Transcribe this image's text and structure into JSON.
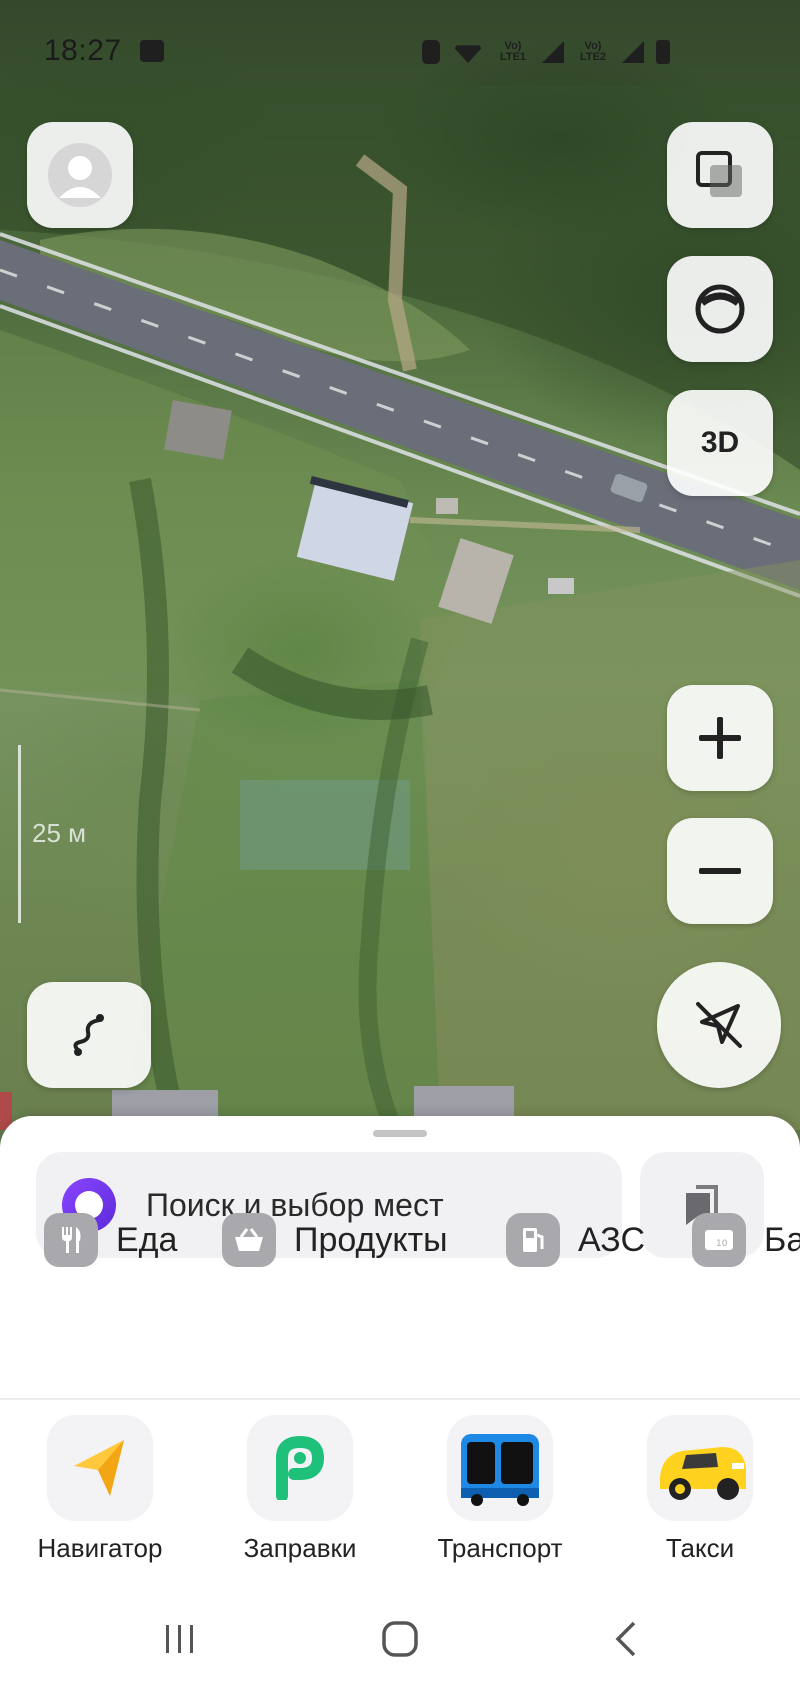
{
  "status_bar": {
    "time": "18:27",
    "lte1": "Vo) LTE1",
    "lte2": "Vo) LTE2",
    "icons": [
      "gallery-icon",
      "alarm-icon",
      "wifi-icon",
      "signal-icon",
      "signal-icon",
      "battery-icon"
    ]
  },
  "map": {
    "layers_icon": "layers-icon",
    "orientation_icon": "compass-icon",
    "btn_3d_label": "3D",
    "zoom_in_label": "+",
    "zoom_out_label": "−",
    "scale_label": "25 м",
    "route_icon": "route-icon",
    "location_icon": "location-off-icon"
  },
  "search": {
    "placeholder": "Поиск и выбор мест",
    "bookmarks_icon": "bookmarks-icon"
  },
  "categories": [
    {
      "label": "Еда",
      "icon": "fork-knife-icon"
    },
    {
      "label": "Продукты",
      "icon": "basket-icon"
    },
    {
      "label": "АЗС",
      "icon": "fuel-icon"
    },
    {
      "label": "Ба",
      "icon": "atm-icon"
    }
  ],
  "apps": [
    {
      "label": "Навигатор",
      "icon": "navigator-icon"
    },
    {
      "label": "Заправки",
      "icon": "fuel-app-icon"
    },
    {
      "label": "Транспорт",
      "icon": "bus-icon"
    },
    {
      "label": "Такси",
      "icon": "taxi-icon"
    }
  ],
  "colors": {
    "alice_purple": "#6a35e8",
    "fuel_green": "#1ec07a",
    "bus_blue": "#1e88e5",
    "taxi_yellow": "#ffd21f",
    "navigator_yellow": "#ffc83d"
  }
}
